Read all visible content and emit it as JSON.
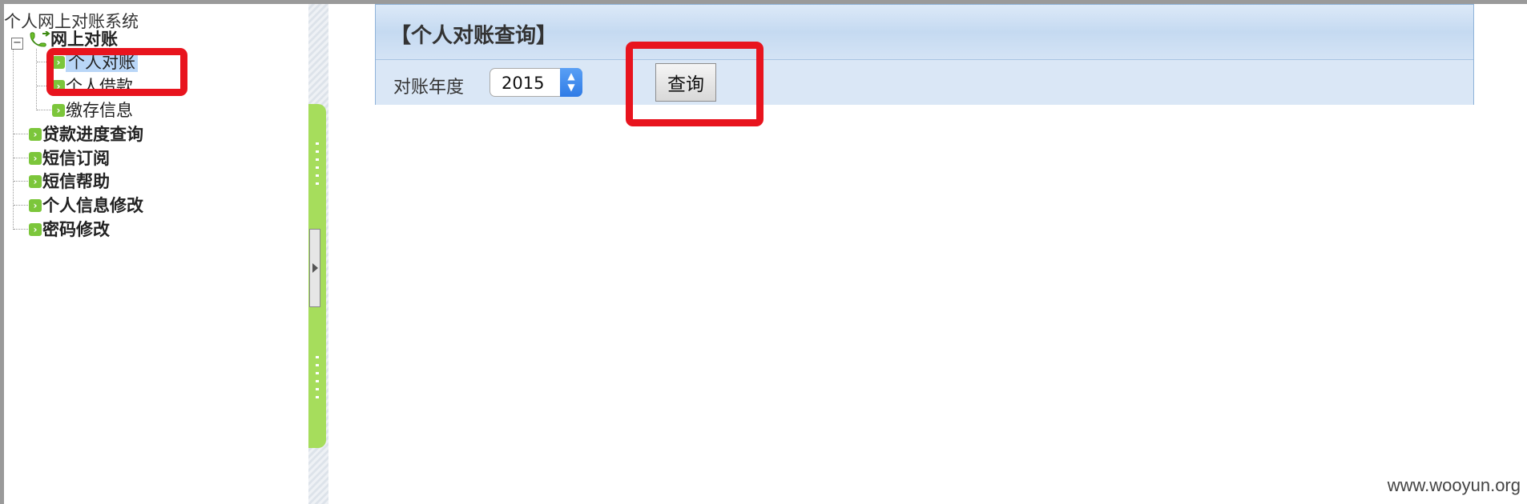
{
  "app": {
    "title": "个人网上对账系统"
  },
  "tree": {
    "group": {
      "label": "网上对账",
      "icon": "phone-icon",
      "expanded": true,
      "children": [
        {
          "label": "个人对账",
          "selected": true
        },
        {
          "label": "个人借款"
        },
        {
          "label": "缴存信息"
        }
      ]
    },
    "items": [
      {
        "label": "贷款进度查询"
      },
      {
        "label": "短信订阅"
      },
      {
        "label": "短信帮助"
      },
      {
        "label": "个人信息修改"
      },
      {
        "label": "密码修改"
      }
    ]
  },
  "panel": {
    "title": "【个人对账查询】",
    "year_label": "对账年度",
    "year_value": "2015",
    "query_button": "查询"
  },
  "colors": {
    "highlight": "#e8141e",
    "leaf_icon": "#7cc63b",
    "selection": "#b9d6f7",
    "panel_bg": "#d9e8f7"
  },
  "watermark": "www.wooyun.org"
}
